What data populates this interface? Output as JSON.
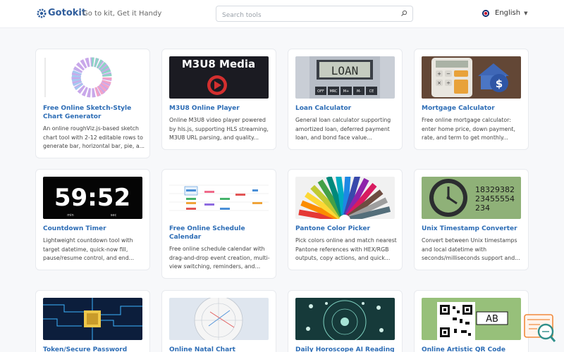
{
  "header": {
    "brand": "Gotokit",
    "tagline": "Go to kit, Get it Handy",
    "search_placeholder": "Search tools",
    "language": "English"
  },
  "colors": {
    "brand": "#2f5d9c",
    "link": "#2c6cb5",
    "background": "#f7f8fa"
  },
  "cards": [
    {
      "title": "Free Online Sketch-Style Chart Generator",
      "desc": "An online roughViz.js-based sketch chart tool with 2-12 editable rows to generate bar, horizontal bar, pie, a..."
    },
    {
      "title": "M3U8 Online Player",
      "desc": "Online M3U8 video player powered by hls.js, supporting HLS streaming, M3U8 URL parsing, and quality..."
    },
    {
      "title": "Loan Calculator",
      "desc": "General loan calculator supporting amortized loan, deferred payment loan, and bond face value..."
    },
    {
      "title": "Mortgage Calculator",
      "desc": "Free online mortgage calculator: enter home price, down payment, rate, and term to get monthly..."
    },
    {
      "title": "Countdown Timer",
      "desc": "Lightweight countdown tool with target datetime, quick-now fill, pause/resume control, and end..."
    },
    {
      "title": "Free Online Schedule Calendar",
      "desc": "Free online schedule calendar with drag-and-drop event creation, multi-view switching, reminders, and more."
    },
    {
      "title": "Pantone Color Picker",
      "desc": "Pick colors online and match nearest Pantone references with HEX/RGB outputs, copy actions, and quick..."
    },
    {
      "title": "Unix Timestamp Converter",
      "desc": "Convert between Unix timestamps and local datetime with seconds/milliseconds support and..."
    },
    {
      "title": "Token/Secure Password",
      "desc": ""
    },
    {
      "title": "Online Natal Chart",
      "desc": ""
    },
    {
      "title": "Daily Horoscope AI Reading",
      "desc": ""
    },
    {
      "title": "Online Artistic QR Code",
      "desc": ""
    }
  ],
  "thumbs": {
    "m3u8_text": "M3U8 Media",
    "loan_text": "LOAN",
    "loan_keys": [
      "OFF",
      "MRC",
      "M+",
      "M-",
      "CE"
    ],
    "timer_text": "59:52",
    "timer_min": "min",
    "timer_sec": "sec",
    "unix_lines": [
      "18329382",
      "23455554",
      "234"
    ],
    "qr_text": "AB"
  }
}
